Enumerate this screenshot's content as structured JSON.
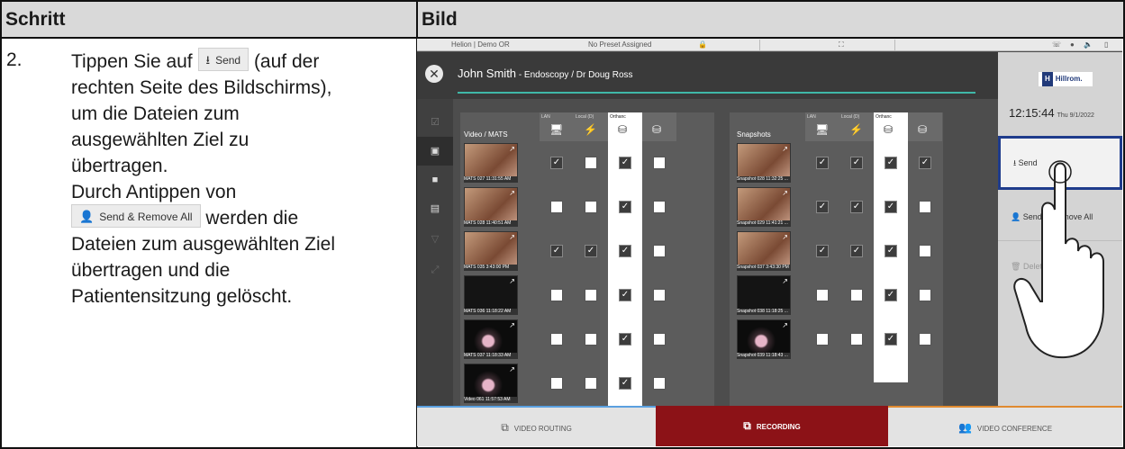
{
  "header": {
    "step_col": "Schritt",
    "image_col": "Bild"
  },
  "step": {
    "number": "2.",
    "lines": {
      "l1_pre": "Tippen Sie auf",
      "l1_btn": "Send",
      "l1_post": "(auf der",
      "l2": "rechten Seite des Bildschirms),",
      "l3": "um die Dateien zum",
      "l4": "ausgewählten Ziel zu",
      "l5": "übertragen.",
      "l6": "Durch Antippen von",
      "l7_btn": "Send & Remove All",
      "l7_post": "werden die",
      "l8": "Dateien zum ausgewählten Ziel",
      "l9": "übertragen und die",
      "l10": "Patientensitzung gelöscht."
    }
  },
  "screen": {
    "topbar": {
      "room": "Helion | Demo OR",
      "preset": "No Preset Assigned"
    },
    "patient": {
      "name": "John Smith",
      "detail": " - Endoscopy / Dr Doug Ross"
    },
    "logo": "Hillrom.",
    "logo_mark": "H",
    "clock": {
      "time": "12:15:44",
      "date": "Thu 9/1/2022"
    },
    "right_actions": {
      "send": "Send",
      "send_remove": "Send & Remove All",
      "delete": "Delete"
    },
    "columns": {
      "lan": "LAN",
      "local": "Local (D)",
      "orthanc": "Orthanc"
    },
    "left_title": "Video / MATS",
    "right_title": "Snapshots",
    "video_items": [
      {
        "caption": "MATS 027 11:31:55 AM",
        "checks": [
          true,
          false,
          true,
          false
        ]
      },
      {
        "caption": "MATS 028 11:40:51 AM",
        "checks": [
          false,
          false,
          true,
          false
        ]
      },
      {
        "caption": "MATS 035 3:43:00 PM",
        "checks": [
          true,
          true,
          true,
          false
        ]
      },
      {
        "caption": "MATS 036 11:18:22 AM",
        "checks": [
          false,
          false,
          true,
          false
        ]
      },
      {
        "caption": "MATS 037 11:18:33 AM",
        "checks": [
          false,
          false,
          true,
          false
        ]
      },
      {
        "caption": "Video 061 11:57:53 AM",
        "checks": [
          false,
          false,
          true,
          false
        ]
      }
    ],
    "snapshot_items": [
      {
        "caption": "Snapshot 028 11:32:25 ...",
        "checks": [
          true,
          true,
          true,
          true
        ]
      },
      {
        "caption": "Snapshot 029 11:41:21 ...",
        "checks": [
          true,
          true,
          true,
          false
        ]
      },
      {
        "caption": "Snapshot 037 3:43:30 PM",
        "checks": [
          true,
          true,
          true,
          false
        ]
      },
      {
        "caption": "Snapshot 038 11:18:25 ...",
        "checks": [
          false,
          false,
          true,
          false
        ]
      },
      {
        "caption": "Snapshot 039 11:18:43 ...",
        "checks": [
          false,
          false,
          true,
          false
        ]
      }
    ],
    "bottom_tabs": {
      "routing": "VIDEO ROUTING",
      "recording": "RECORDING",
      "conference": "VIDEO CONFERENCE"
    },
    "colors": {
      "recording": "#8c1217",
      "accent_teal": "#3fb8a8",
      "highlight": "#1f3c8c"
    }
  }
}
